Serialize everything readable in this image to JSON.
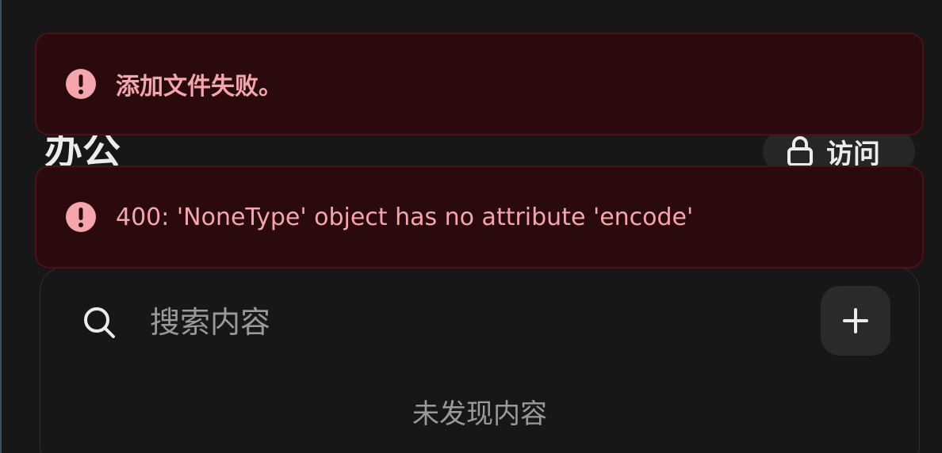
{
  "header": {
    "title": "办公",
    "access_label": "访问"
  },
  "search": {
    "placeholder": "搜索内容"
  },
  "content": {
    "empty_text": "未发现内容"
  },
  "toasts": [
    {
      "message": "添加文件失败。",
      "icon": "alert-circle-icon"
    },
    {
      "message": "400: 'NoneType' object has no attribute 'encode'",
      "icon": "alert-circle-icon"
    }
  ],
  "colors": {
    "background": "#171717",
    "toast_background": "#2b0a0d",
    "toast_text": "#f4a6ac",
    "icon_fill": "#f4a6ac"
  }
}
